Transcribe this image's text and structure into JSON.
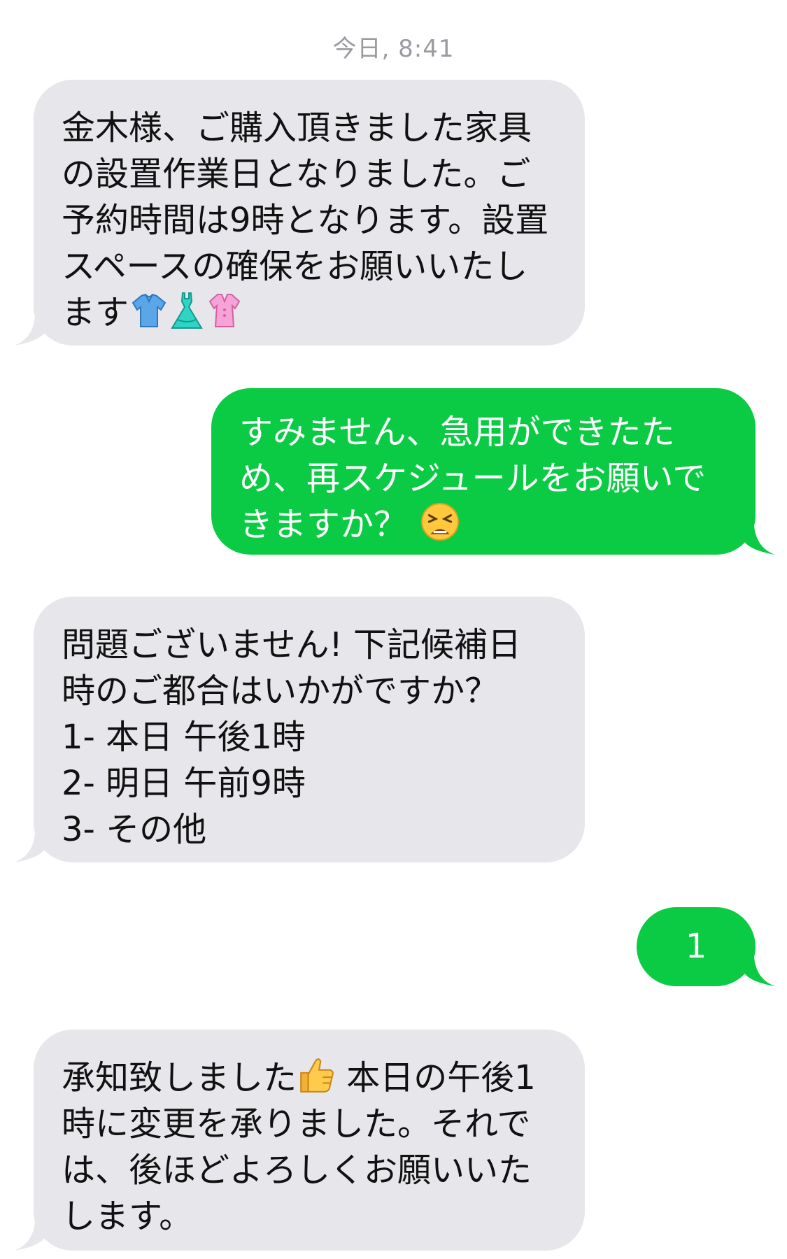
{
  "timestamp": "今日, 8:41",
  "messages": [
    {
      "sender": "incoming",
      "lines": [
        "金木様、ご購入頂きました家具",
        "の設置作業日となりました。ご",
        "予約時間は9時となります。設置",
        "スペースの確保をお願いいたし",
        "ます"
      ],
      "emojis": [
        "shirt-icon",
        "dress-icon",
        "blouse-icon"
      ]
    },
    {
      "sender": "outgoing",
      "lines": [
        "すみません、急用ができたた",
        "め、再スケジュールをお願いで",
        "きますか？ "
      ],
      "emojis": [
        "tired-face-icon"
      ]
    },
    {
      "sender": "incoming",
      "lines": [
        "問題ございません! 下記候補日",
        "時のご都合はいかがですか？",
        "1- 本日 午後1時",
        "2- 明日 午前9時",
        "3- その他"
      ]
    },
    {
      "sender": "outgoing",
      "lines": [
        "1"
      ]
    },
    {
      "sender": "incoming",
      "lines": [
        "承知致しました",
        " 本日の午後1",
        "時に変更を承りました。それで",
        "は、後ほどよろしくお願いいた",
        "します。"
      ],
      "emojis": [
        "thumbs-up-icon"
      ]
    }
  ],
  "colors": {
    "incoming_bubble": "#e6e6eb",
    "outgoing_bubble": "#0bcb45",
    "timestamp": "#9a9aa0"
  }
}
